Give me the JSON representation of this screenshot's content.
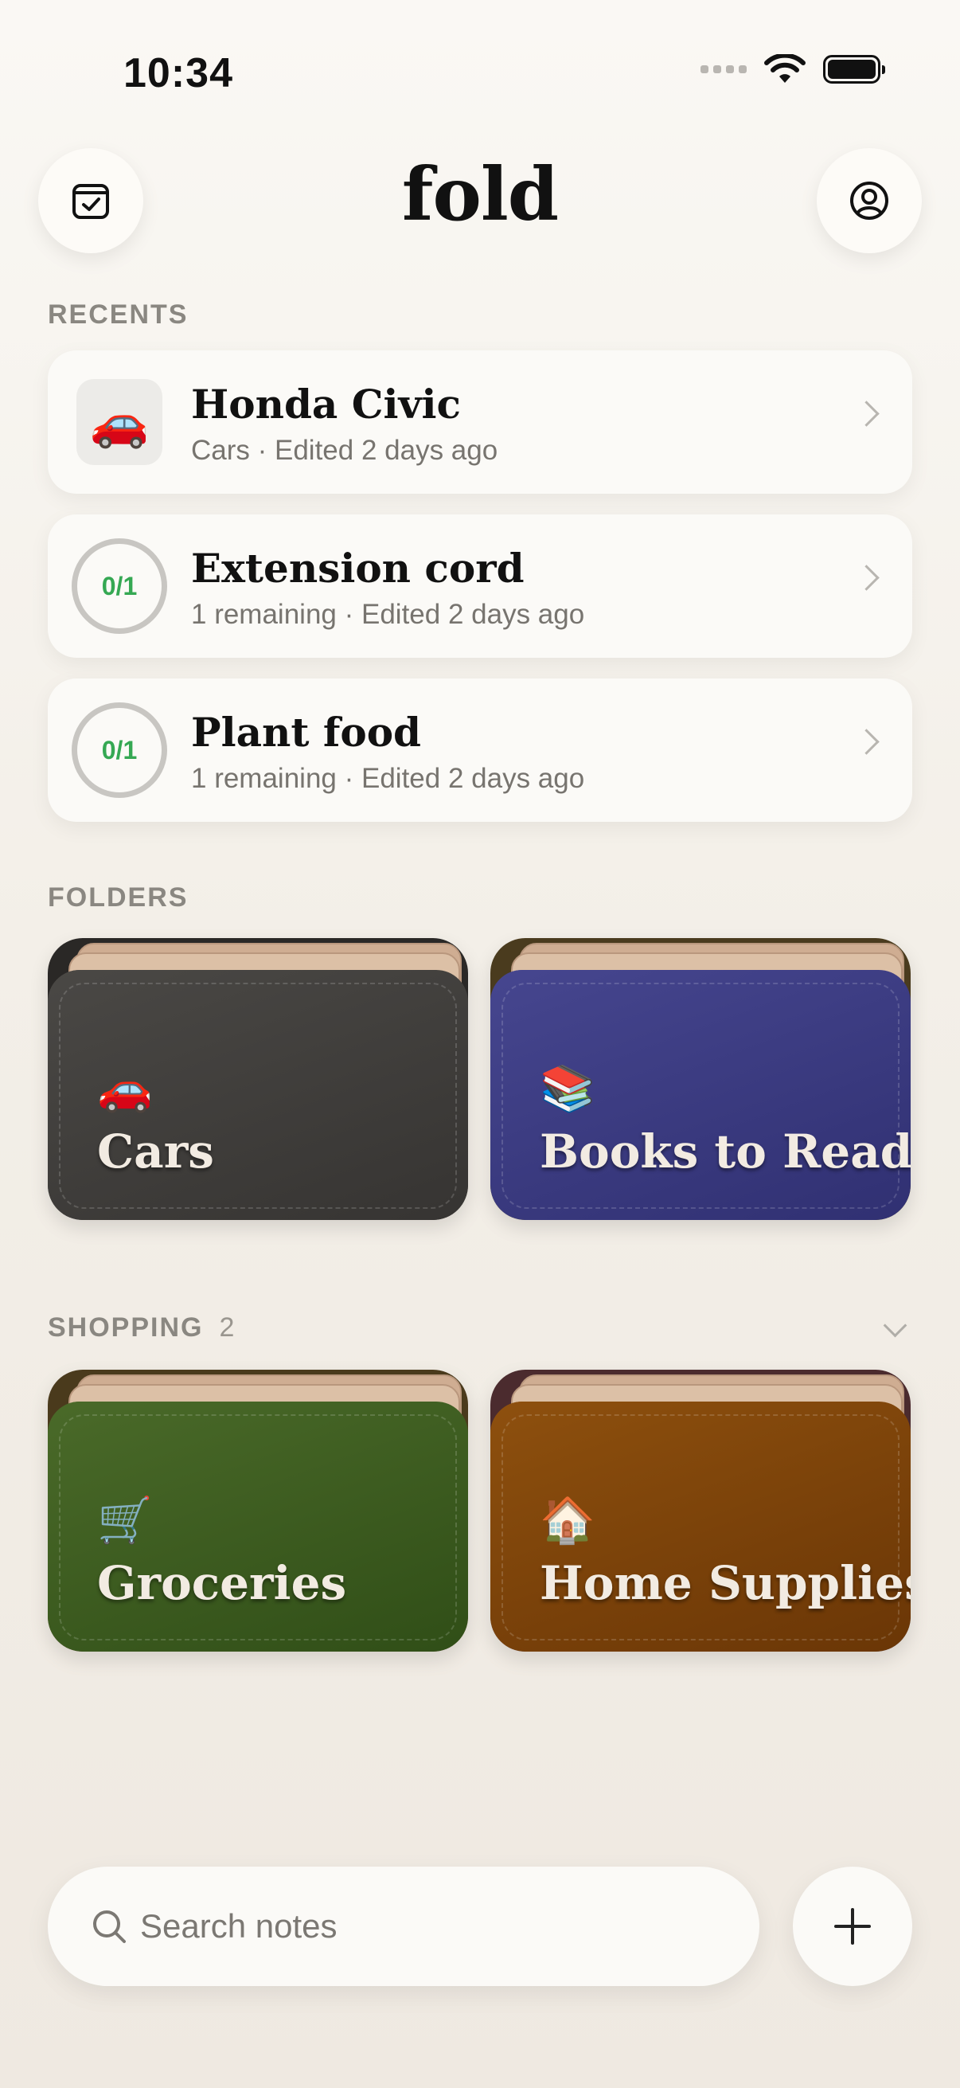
{
  "status_bar": {
    "time": "10:34"
  },
  "header": {
    "title": "fold",
    "left_icon": "calendar-check-icon",
    "right_icon": "user-circle-icon"
  },
  "recents": {
    "label": "RECENTS",
    "items": [
      {
        "title": "Honda Civic",
        "subtitle": "Cars · Edited 2 days ago",
        "emoji": "🚗"
      },
      {
        "title": "Extension cord",
        "subtitle": "1 remaining · Edited 2 days ago",
        "progress": "0/1"
      },
      {
        "title": "Plant food",
        "subtitle": "1 remaining · Edited 2 days ago",
        "progress": "0/1"
      }
    ]
  },
  "folders": {
    "label": "FOLDERS",
    "items": [
      {
        "name": "Cars",
        "emoji": "🚗",
        "color": "#3d3b39"
      },
      {
        "name": "Books to Read",
        "emoji": "📚",
        "color": "#36367a"
      }
    ]
  },
  "shopping": {
    "label": "SHOPPING",
    "count": "2",
    "items": [
      {
        "name": "Groceries",
        "emoji": "🛒",
        "color": "#3a5a1f"
      },
      {
        "name": "Home Supplies",
        "emoji": "🏠",
        "color": "#7a4308"
      }
    ]
  },
  "search": {
    "placeholder": "Search notes"
  },
  "colors": {
    "accent_green": "#35a853",
    "background": "#f3efe8"
  }
}
